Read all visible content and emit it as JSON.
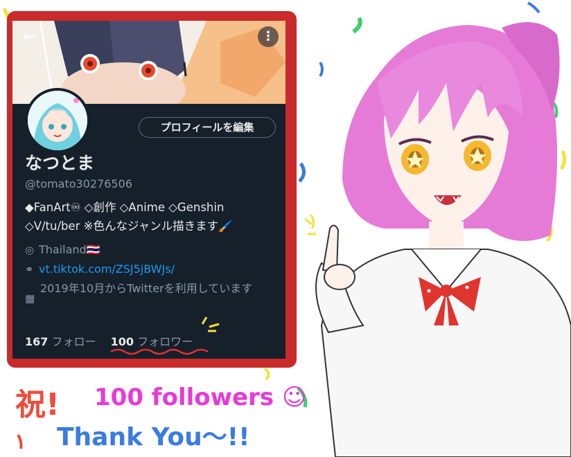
{
  "profile": {
    "back_icon": "←",
    "more_icon": "⋮",
    "edit_button": "プロフィールを編集",
    "display_name": "なつとま",
    "handle": "@tomato30276506",
    "bio_line1": "◆FanArt♾ ◇創作 ◇Anime ◇Genshin",
    "bio_line2": "◇V/tu/ber ※色んなジャンル描きます🖌️",
    "location": "Thailand🇹🇭",
    "website": "vt.tiktok.com/ZSJ5jBWJs/",
    "joined": "2019年10月からTwitterを利用しています",
    "following_count": "167",
    "following_label": "フォロー",
    "followers_count": "100",
    "followers_label": "フォロワー"
  },
  "icons": {
    "location": "location-pin-icon",
    "link": "link-icon",
    "calendar": "calendar-icon"
  },
  "caption": {
    "line1_kanji": "祝!",
    "line1_text": "100 followers ☺",
    "line2": "Thank You～!!"
  },
  "colors": {
    "frame": "#c92a2a",
    "background_dark": "#15202b",
    "link": "#1d9bf0",
    "hair": "#e57bd6",
    "caption_red": "#f04a3a",
    "caption_magenta": "#e63ad8",
    "caption_blue": "#3a7ce0"
  }
}
